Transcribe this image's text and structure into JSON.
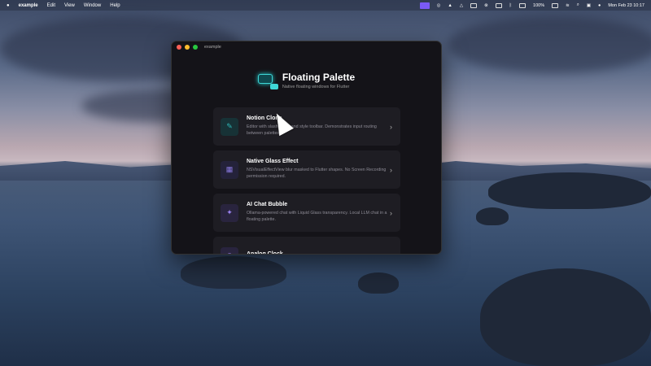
{
  "menubar": {
    "app": "example",
    "items": [
      "Edit",
      "View",
      "Window",
      "Help"
    ],
    "battery": "100%",
    "clock": "Mon Feb 23  10:17"
  },
  "window": {
    "title": "example",
    "header": {
      "title": "Floating Palette",
      "subtitle": "Native floating windows for Flutter"
    },
    "cards": [
      {
        "title": "Notion Clone",
        "description": "Editor with slash menu and style toolbar. Demonstrates input routing between palettes.",
        "icon": "edit-icon",
        "icon_glyph": "✎",
        "color": "#2fb8b8",
        "bg": "#173236"
      },
      {
        "title": "Native Glass Effect",
        "description": "NSVisualEffectView blur masked to Flutter shapes. No Screen Recording permission required.",
        "icon": "grid-icon",
        "icon_glyph": "▦",
        "color": "#8a7ae0",
        "bg": "#24223a"
      },
      {
        "title": "AI Chat Bubble",
        "description": "Ollama-powered chat with Liquid Glass transparency. Local LLM chat in a floating palette.",
        "icon": "sparkle-icon",
        "icon_glyph": "✦",
        "color": "#9a82f0",
        "bg": "#29243e"
      },
      {
        "title": "Analog Clock",
        "description": "",
        "icon": "clock-icon",
        "icon_glyph": "◷",
        "color": "#9a82f0",
        "bg": "#29243e"
      }
    ]
  }
}
